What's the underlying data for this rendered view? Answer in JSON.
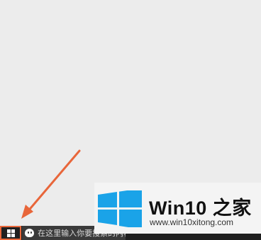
{
  "taskbar": {
    "start_button_icon": "windows-logo-icon",
    "search": {
      "icon": "cortana-icon",
      "placeholder": "在这里输入你要搜索的内容"
    }
  },
  "annotation": {
    "arrow_color": "#e8663a",
    "highlight_color": "#e8663a"
  },
  "watermark": {
    "brand_color": "#1aa3e8",
    "title": "Win10 之家",
    "url": "www.win10xitong.com"
  }
}
